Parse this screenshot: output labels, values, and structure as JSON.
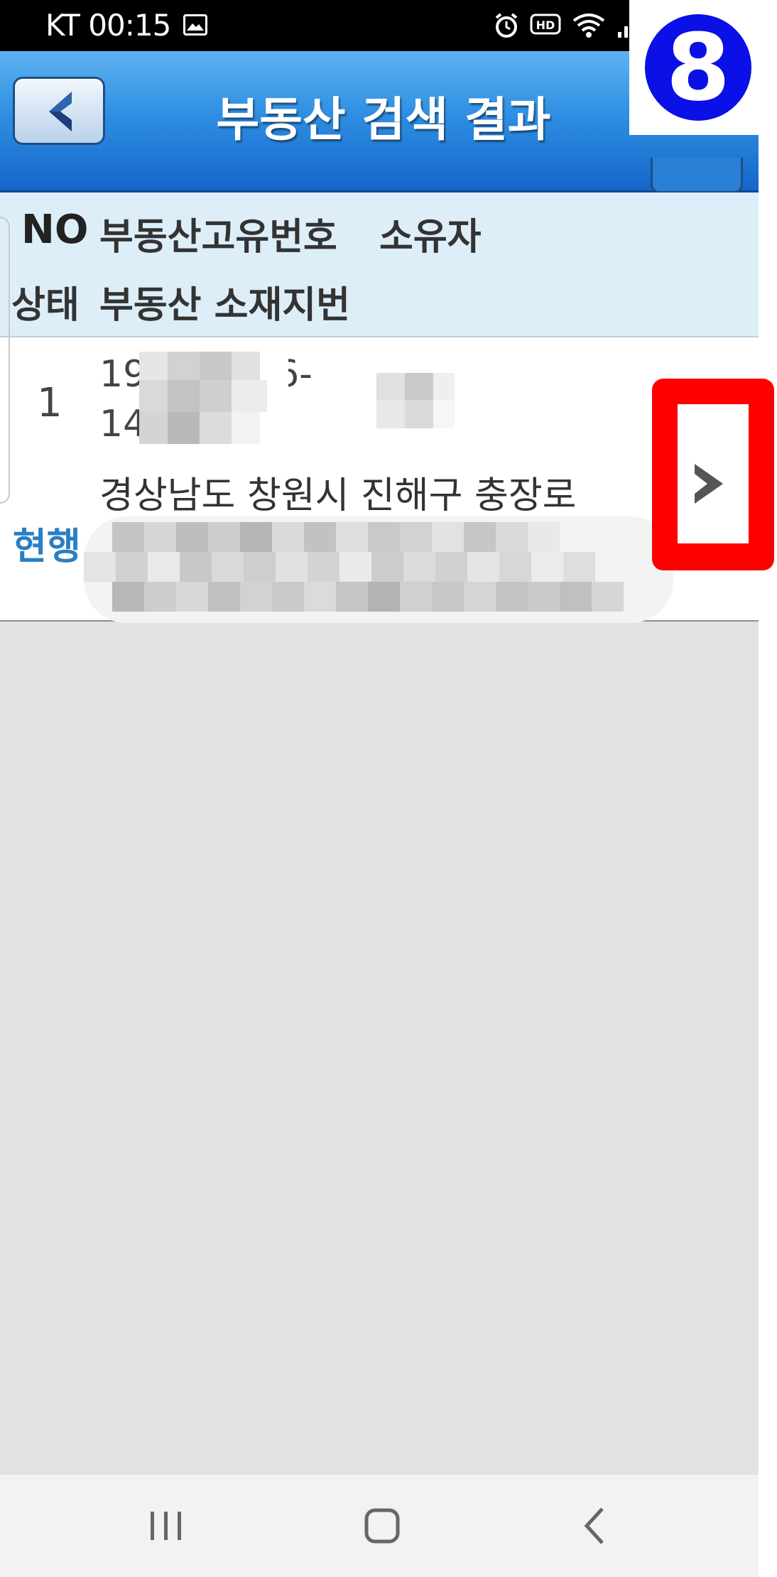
{
  "status_bar": {
    "carrier": "KT",
    "time": "00:15"
  },
  "header": {
    "title": "부동산 검색 결과"
  },
  "step_badge": {
    "number": "8"
  },
  "columns": {
    "no": "NO",
    "unique_number": "부동산고유번호",
    "owner": "소유자",
    "status": "상태",
    "address": "부동산 소재지번"
  },
  "results": [
    {
      "no": "1",
      "unique_number_line1": "19",
      "unique_number_line1_end": "06-",
      "unique_number_line2": "14",
      "address": "경상남도 창원시 진해구 충장로",
      "status": "현행",
      "address_line2_start": "["
    }
  ],
  "navigation": {
    "recent_apps": "recent-apps",
    "home": "home",
    "back": "back"
  }
}
